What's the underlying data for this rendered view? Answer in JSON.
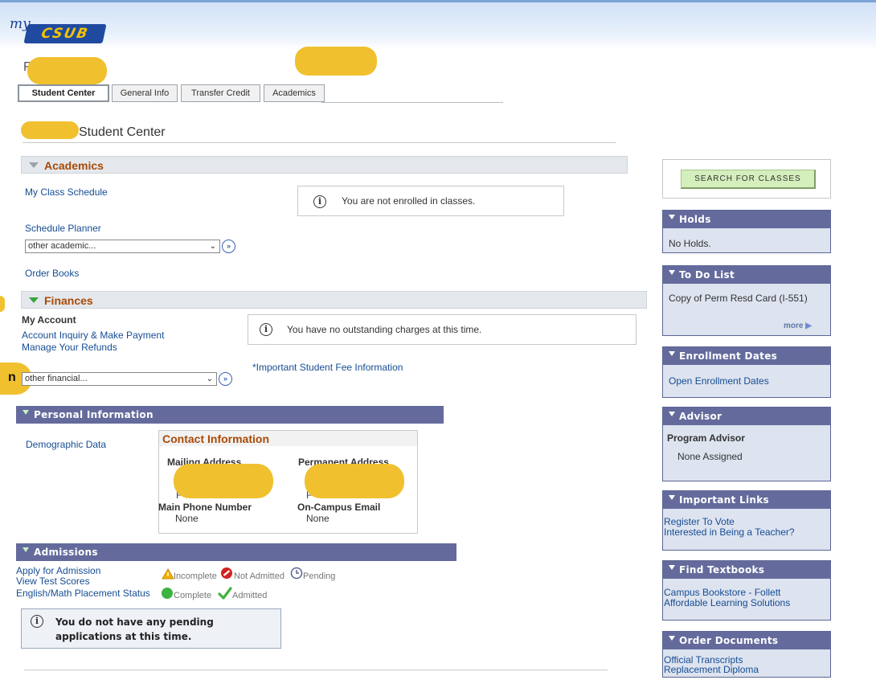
{
  "app": {
    "logo_prefix": "my",
    "logo_name": "CSUB"
  },
  "tabs": [
    {
      "label": "Student Center"
    },
    {
      "label": "General Info"
    },
    {
      "label": "Transfer Credit"
    },
    {
      "label": "Academics"
    }
  ],
  "page": {
    "heading": "Student Center",
    "partial_label_char": "F",
    "side_partial_char": "n"
  },
  "academics": {
    "title": "Academics",
    "links": {
      "class_schedule": "My Class Schedule",
      "schedule_planner": "Schedule Planner",
      "order_books": "Order Books"
    },
    "dropdown": "other academic...",
    "notice": "You are not enrolled in classes."
  },
  "finances": {
    "title": "Finances",
    "my_account": "My Account",
    "links": {
      "inquiry": "Account Inquiry & Make Payment",
      "refunds": "Manage Your Refunds"
    },
    "dropdown": "other financial...",
    "notice": "You have no outstanding charges at this time.",
    "fee_link": "*Important Student Fee Information"
  },
  "personal": {
    "title": "Personal Information",
    "demographic_link": "Demographic Data",
    "contact": {
      "title": "Contact Information",
      "mailing_label": "Mailing Address",
      "permanent_label": "Permanent Address",
      "mailing_fragment": "F          57",
      "permanent_fragment": "F          57",
      "main_phone_label": "Main Phone Number",
      "main_phone_value": "None",
      "email_label": "On-Campus Email",
      "email_value": "None"
    }
  },
  "admissions": {
    "title": "Admissions",
    "links": {
      "apply": "Apply for Admission",
      "test_scores": "View Test Scores",
      "placement": "English/Math Placement Status"
    },
    "legend": {
      "incomplete": "Incomplete",
      "not_admitted": "Not Admitted",
      "pending": "Pending",
      "complete": "Complete",
      "admitted": "Admitted"
    },
    "notice": "You do not have any pending applications at this time."
  },
  "sidebar": {
    "search_button": "Search For Classes",
    "holds": {
      "title": "Holds",
      "text": "No Holds."
    },
    "todo": {
      "title": "To Do List",
      "item": "Copy of Perm Resd Card (I-551)",
      "more": "more"
    },
    "enrollment": {
      "title": "Enrollment Dates",
      "link": "Open Enrollment Dates"
    },
    "advisor": {
      "title": "Advisor",
      "role": "Program Advisor",
      "name": "None Assigned"
    },
    "important_links": {
      "title": "Important Links",
      "links": [
        "Register To Vote",
        "Interested in Being a Teacher?"
      ]
    },
    "textbooks": {
      "title": "Find Textbooks",
      "links": [
        "Campus Bookstore - Follett",
        "Affordable Learning Solutions"
      ]
    },
    "documents": {
      "title": "Order Documents",
      "links": [
        "Official Transcripts",
        "Replacement Diploma"
      ]
    }
  },
  "colors": {
    "section_header_dark": "#646b9c",
    "section_title_orange": "#a94a06",
    "link_blue": "#164d93",
    "redaction": "#f0c02f",
    "search_button": "#d4eebc"
  }
}
